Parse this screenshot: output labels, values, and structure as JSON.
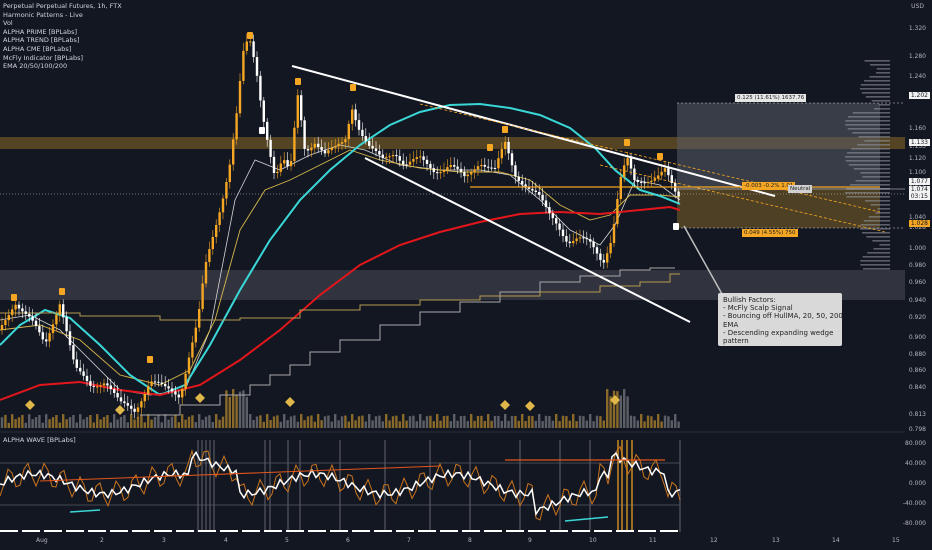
{
  "legend": {
    "title": "Perpetual Perpetual Futures, 1h, FTX",
    "indicators": [
      "Harmonic Patterns - Live",
      "Vol",
      "ALPHA PRIME [BPLabs]",
      "ALPHA TREND [BPLabs]",
      "ALPHA CME [BPLabs]",
      "McFly Indicator [BPLabs]",
      "EMA 20/50/100/200"
    ]
  },
  "sub_legend": "ALPHA WAVE [BPLabs]",
  "currency": "USD",
  "price_ticks": [
    "1.320",
    "1.280",
    "1.240",
    "1.202",
    "1.160",
    "1.133",
    "1.120",
    "1.100",
    "1.077",
    "1.074",
    "1.040",
    "1.028",
    "1.000",
    "0.980",
    "0.960",
    "0.940",
    "0.920",
    "0.900",
    "0.880",
    "0.860",
    "0.840",
    "0.813",
    "0.798"
  ],
  "price_badges": [
    {
      "text": "1.202",
      "color": "#f2f2f2"
    },
    {
      "text": "1.133",
      "color": "#f2f2f2"
    },
    {
      "text": "1.077",
      "color": "#f2f2f2"
    },
    {
      "text": "1.074",
      "color": "#f2f2f2"
    },
    {
      "text": "03:15",
      "color": "#f2f2f2"
    },
    {
      "text": "1.028",
      "color": "#f5a623"
    }
  ],
  "osc_ticks": [
    "80.000",
    "40.000",
    "0.000",
    "-40.000",
    "-80.000"
  ],
  "time_ticks": [
    "Aug",
    "2",
    "3",
    "4",
    "5",
    "6",
    "7",
    "8",
    "9",
    "10",
    "11",
    "12",
    "13",
    "14",
    "15"
  ],
  "annotations": {
    "target_top": "0.125 (11.61%) 1637.76",
    "target_bottom": "0.049 (4.55%) 750",
    "entry": "-0.003  -0.2%",
    "entry_sub": "1.01",
    "neutral": "Neutral"
  },
  "note": {
    "lines": [
      "Bullish Factors:",
      "- McFly Scalp Signal",
      "- Bouncing off HullMA, 20, 50, 200",
      "EMA",
      "- Descending expanding wedge",
      "pattern"
    ]
  },
  "colors": {
    "background": "#131722",
    "up": "#f5a623",
    "down": "#ffffff",
    "ema_cyan": "#3ad7d7",
    "ema_red": "#e3161b",
    "ema_yellow": "#d8b84a",
    "zone": "#8a6a25"
  }
}
